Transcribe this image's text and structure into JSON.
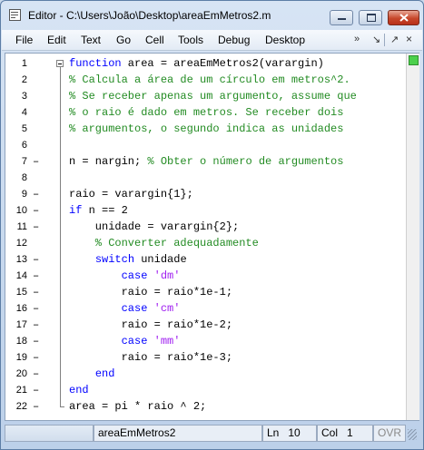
{
  "window": {
    "title": "Editor - C:\\Users\\João\\Desktop\\areaEmMetros2.m",
    "buttons": {
      "minimize": "minimize-icon",
      "maximize": "maximize-icon",
      "close": "close-icon"
    }
  },
  "menubar": {
    "items": [
      "File",
      "Edit",
      "Text",
      "Go",
      "Cell",
      "Tools",
      "Debug",
      "Desktop"
    ],
    "toolbar_icons": {
      "overflow": "»",
      "dock": "↘",
      "undock": "↗",
      "close": "×"
    }
  },
  "editor": {
    "lines": [
      {
        "n": "1",
        "bp": "",
        "tokens": [
          {
            "t": "function",
            "c": "kw"
          },
          {
            "t": " area = areaEmMetros2(varargin)",
            "c": "plain"
          }
        ]
      },
      {
        "n": "2",
        "bp": "",
        "tokens": [
          {
            "t": "% Calcula a área de um círculo em metros^2.",
            "c": "cm"
          }
        ]
      },
      {
        "n": "3",
        "bp": "",
        "tokens": [
          {
            "t": "% Se receber apenas um argumento, assume que",
            "c": "cm"
          }
        ]
      },
      {
        "n": "4",
        "bp": "",
        "tokens": [
          {
            "t": "% o raio é dado em metros. Se receber dois",
            "c": "cm"
          }
        ]
      },
      {
        "n": "5",
        "bp": "",
        "tokens": [
          {
            "t": "% argumentos, o segundo indica as unidades",
            "c": "cm"
          }
        ]
      },
      {
        "n": "6",
        "bp": "",
        "tokens": []
      },
      {
        "n": "7",
        "bp": "–",
        "tokens": [
          {
            "t": "n = nargin; ",
            "c": "plain"
          },
          {
            "t": "% Obter o número de argumentos",
            "c": "cm"
          }
        ]
      },
      {
        "n": "8",
        "bp": "",
        "tokens": []
      },
      {
        "n": "9",
        "bp": "–",
        "tokens": [
          {
            "t": "raio = varargin{1};",
            "c": "plain"
          }
        ]
      },
      {
        "n": "10",
        "bp": "–",
        "tokens": [
          {
            "t": "if",
            "c": "kw"
          },
          {
            "t": " n == 2",
            "c": "plain"
          }
        ]
      },
      {
        "n": "11",
        "bp": "–",
        "tokens": [
          {
            "t": "    unidade = varargin{2};",
            "c": "plain"
          }
        ]
      },
      {
        "n": "12",
        "bp": "",
        "tokens": [
          {
            "t": "    % Converter adequadamente",
            "c": "cm"
          }
        ]
      },
      {
        "n": "13",
        "bp": "–",
        "tokens": [
          {
            "t": "    ",
            "c": "plain"
          },
          {
            "t": "switch",
            "c": "kw"
          },
          {
            "t": " unidade",
            "c": "plain"
          }
        ]
      },
      {
        "n": "14",
        "bp": "–",
        "tokens": [
          {
            "t": "        ",
            "c": "plain"
          },
          {
            "t": "case",
            "c": "kw"
          },
          {
            "t": " ",
            "c": "plain"
          },
          {
            "t": "'dm'",
            "c": "str"
          }
        ]
      },
      {
        "n": "15",
        "bp": "–",
        "tokens": [
          {
            "t": "        raio = raio*1e-1;",
            "c": "plain"
          }
        ]
      },
      {
        "n": "16",
        "bp": "–",
        "tokens": [
          {
            "t": "        ",
            "c": "plain"
          },
          {
            "t": "case",
            "c": "kw"
          },
          {
            "t": " ",
            "c": "plain"
          },
          {
            "t": "'cm'",
            "c": "str"
          }
        ]
      },
      {
        "n": "17",
        "bp": "–",
        "tokens": [
          {
            "t": "        raio = raio*1e-2;",
            "c": "plain"
          }
        ]
      },
      {
        "n": "18",
        "bp": "–",
        "tokens": [
          {
            "t": "        ",
            "c": "plain"
          },
          {
            "t": "case",
            "c": "kw"
          },
          {
            "t": " ",
            "c": "plain"
          },
          {
            "t": "'mm'",
            "c": "str"
          }
        ]
      },
      {
        "n": "19",
        "bp": "–",
        "tokens": [
          {
            "t": "        raio = raio*1e-3;",
            "c": "plain"
          }
        ]
      },
      {
        "n": "20",
        "bp": "–",
        "tokens": [
          {
            "t": "    ",
            "c": "plain"
          },
          {
            "t": "end",
            "c": "kw"
          }
        ]
      },
      {
        "n": "21",
        "bp": "–",
        "tokens": [
          {
            "t": "end",
            "c": "kw"
          }
        ]
      },
      {
        "n": "22",
        "bp": "–",
        "tokens": [
          {
            "t": "area = pi * raio ^ 2;",
            "c": "plain"
          }
        ]
      }
    ],
    "colors": {
      "keyword": "#0000ff",
      "comment": "#228b22",
      "string": "#a020f0"
    }
  },
  "statusbar": {
    "function_name": "areaEmMetros2",
    "ln_label": "Ln",
    "ln_value": "10",
    "col_label": "Col",
    "col_value": "1",
    "ovr": "OVR"
  }
}
